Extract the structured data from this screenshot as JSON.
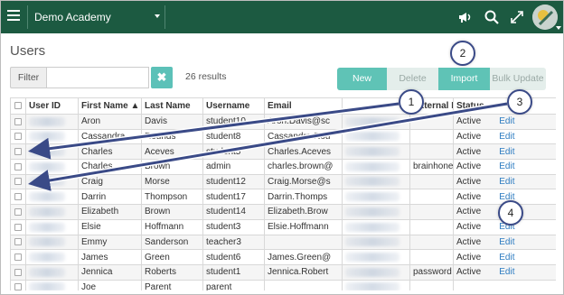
{
  "topbar": {
    "school": "Demo Academy",
    "icons": [
      "menu-icon",
      "megaphone-icon",
      "search-icon",
      "expand-icon",
      "avatar"
    ]
  },
  "page": {
    "title": "Users"
  },
  "filter": {
    "label": "Filter",
    "value": "",
    "placeholder": "",
    "clear_symbol": "✖",
    "results": "26 results"
  },
  "actions": {
    "new": "New",
    "delete": "Delete",
    "import": "Import",
    "bulk_update": "Bulk Update"
  },
  "table": {
    "headers": [
      "User ID",
      "First Name ▲",
      "Last Name",
      "Username",
      "Email",
      "External ID",
      "Status"
    ],
    "rows": [
      {
        "first": "Aron",
        "last": "Davis",
        "username": "student10",
        "email": "Aron.Davis@sc",
        "external": "",
        "status": "Active",
        "action": "Edit"
      },
      {
        "first": "Cassandra",
        "last": "Rounds",
        "username": "student8",
        "email": "Cassandra.Rou",
        "external": "",
        "status": "Active",
        "action": "Edit"
      },
      {
        "first": "Charles",
        "last": "Aceves",
        "username": "student5",
        "email": "Charles.Aceves",
        "external": "",
        "status": "Active",
        "action": "Edit"
      },
      {
        "first": "Charles",
        "last": "Brown",
        "username": "admin",
        "email": "charles.brown@",
        "external": "brainhoney",
        "status": "Active",
        "action": "Edit"
      },
      {
        "first": "Craig",
        "last": "Morse",
        "username": "student12",
        "email": "Craig.Morse@s",
        "external": "",
        "status": "Active",
        "action": "Edit"
      },
      {
        "first": "Darrin",
        "last": "Thompson",
        "username": "student17",
        "email": "Darrin.Thomps",
        "external": "",
        "status": "Active",
        "action": "Edit"
      },
      {
        "first": "Elizabeth",
        "last": "Brown",
        "username": "student14",
        "email": "Elizabeth.Brow",
        "external": "",
        "status": "Active",
        "action": "Edit"
      },
      {
        "first": "Elsie",
        "last": "Hoffmann",
        "username": "student3",
        "email": "Elsie.Hoffmann",
        "external": "",
        "status": "Active",
        "action": "Edit"
      },
      {
        "first": "Emmy",
        "last": "Sanderson",
        "username": "teacher3",
        "email": "",
        "external": "",
        "status": "Active",
        "action": "Edit"
      },
      {
        "first": "James",
        "last": "Green",
        "username": "student6",
        "email": "James.Green@",
        "external": "",
        "status": "Active",
        "action": "Edit"
      },
      {
        "first": "Jennica",
        "last": "Roberts",
        "username": "student1",
        "email": "Jennica.Robert",
        "external": "password",
        "status": "Active",
        "action": "Edit"
      },
      {
        "first": "Joe",
        "last": "Parent",
        "username": "parent",
        "email": "",
        "external": "",
        "status": "",
        "action": ""
      }
    ]
  },
  "annotations": {
    "badges": [
      "1",
      "2",
      "3",
      "4"
    ],
    "color": "#3a4a87"
  },
  "colors": {
    "topbar": "#1c5a41",
    "accent": "#5fc3b6",
    "disabled_button": "#e4eeeb",
    "link": "#2a7ac0"
  }
}
